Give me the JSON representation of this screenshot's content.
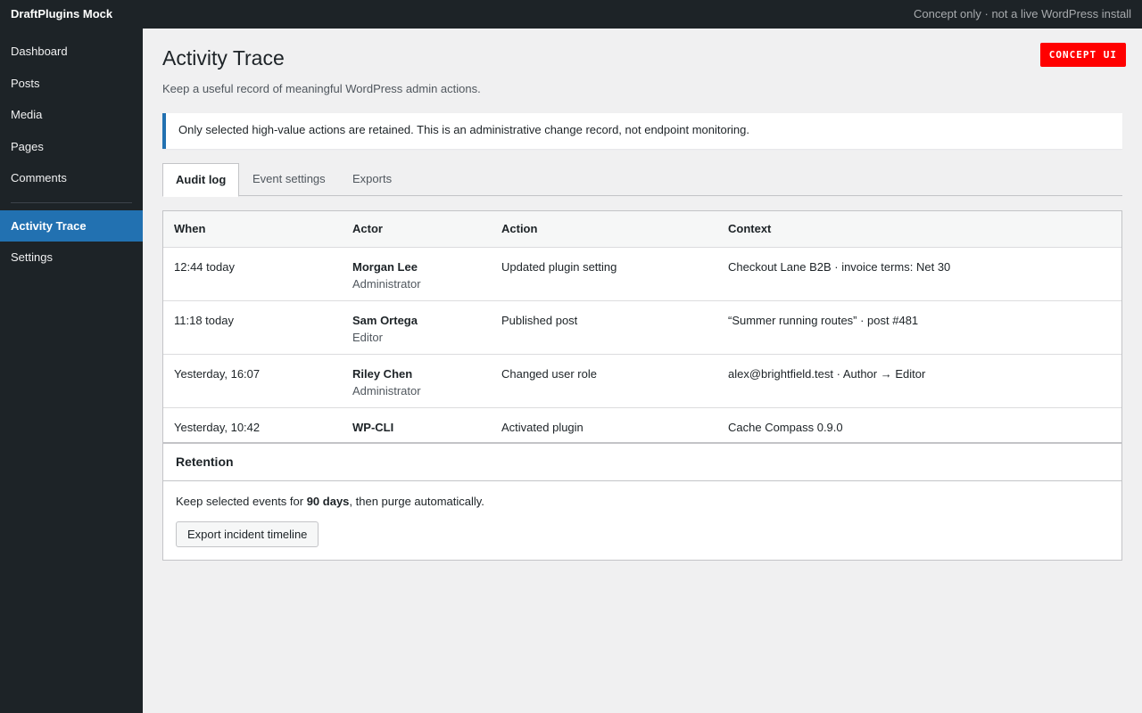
{
  "topbar": {
    "brand": "DraftPlugins Mock",
    "note": "Concept only · not a live WordPress install"
  },
  "sidebar": {
    "items": [
      {
        "label": "Dashboard"
      },
      {
        "label": "Posts"
      },
      {
        "label": "Media"
      },
      {
        "label": "Pages"
      },
      {
        "label": "Comments"
      }
    ],
    "items_after_separator": [
      {
        "label": "Activity Trace",
        "active": true
      },
      {
        "label": "Settings"
      }
    ]
  },
  "badge": "CONCEPT UI",
  "page": {
    "title": "Activity Trace",
    "subtitle": "Keep a useful record of meaningful WordPress admin actions."
  },
  "notice": "Only selected high-value actions are retained. This is an administrative change record, not endpoint monitoring.",
  "tabs": [
    {
      "label": "Audit log",
      "active": true
    },
    {
      "label": "Event settings"
    },
    {
      "label": "Exports"
    }
  ],
  "table": {
    "headers": [
      "When",
      "Actor",
      "Action",
      "Context"
    ],
    "rows": [
      {
        "when": "12:44 today",
        "actor": "Morgan Lee",
        "role": "Administrator",
        "action": "Updated plugin setting",
        "context": "Checkout Lane B2B · invoice terms: Net 30"
      },
      {
        "when": "11:18 today",
        "actor": "Sam Ortega",
        "role": "Editor",
        "action": "Published post",
        "context": "“Summer running routes” · post #481"
      },
      {
        "when": "Yesterday, 16:07",
        "actor": "Riley Chen",
        "role": "Administrator",
        "action": "Changed user role",
        "context": "alex@brightfield.test · Author → Editor"
      },
      {
        "when": "Yesterday, 10:42",
        "actor": "WP-CLI",
        "role": "",
        "action": "Activated plugin",
        "context": "Cache Compass 0.9.0"
      }
    ]
  },
  "retention": {
    "title": "Retention",
    "text_before": "Keep selected events for ",
    "days": "90 days",
    "text_after": ", then purge automatically.",
    "button": "Export incident timeline"
  },
  "colors": {
    "admin_bar": "#1d2327",
    "accent": "#2271b1",
    "badge": "#ff0000"
  }
}
